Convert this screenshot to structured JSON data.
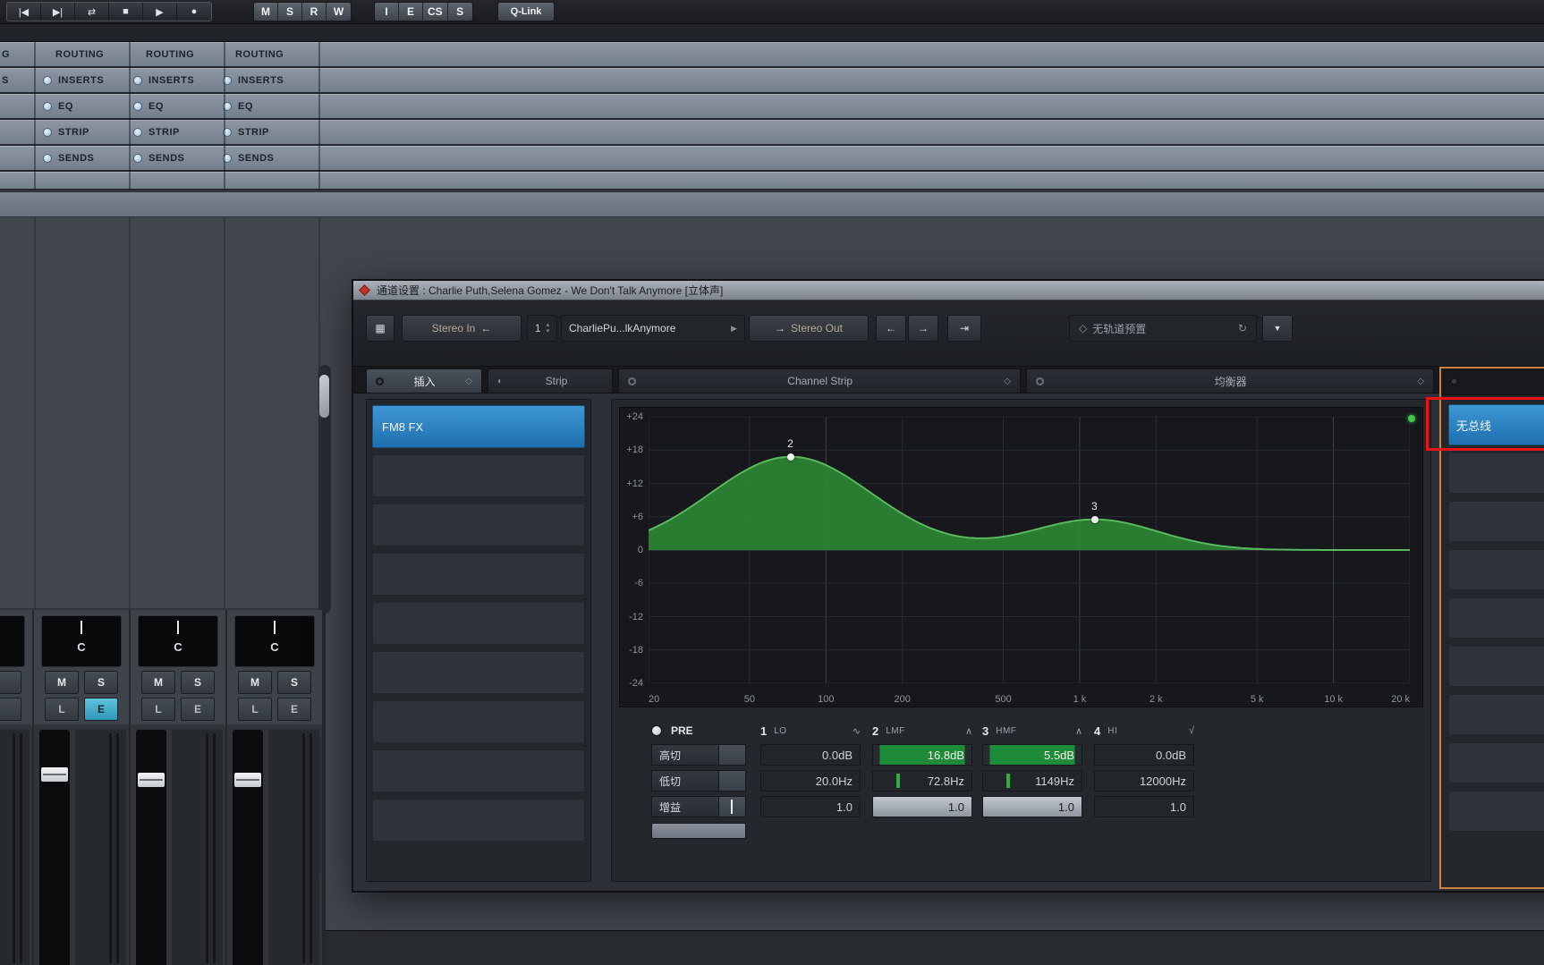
{
  "transport": {
    "to_start_icon": "|◀",
    "to_end_icon": "▶|",
    "cycle_icon": "⇄",
    "stop_icon": "■",
    "play_icon": "▶",
    "record_icon": "●",
    "channel_buttons": [
      "M",
      "S",
      "R",
      "W"
    ],
    "view_buttons": [
      "I",
      "E",
      "CS",
      "S"
    ],
    "qlink_label": "Q-Link"
  },
  "rack": {
    "edge_cut_labels": [
      "G",
      "S"
    ],
    "columns": [
      {
        "labels": [
          "ROUTING",
          "INSERTS",
          "EQ",
          "STRIP",
          "SENDS"
        ]
      },
      {
        "labels": [
          "ROUTING",
          "INSERTS",
          "EQ",
          "STRIP",
          "SENDS"
        ]
      },
      {
        "labels": [
          "ROUTING",
          "INSERTS",
          "EQ",
          "STRIP",
          "SENDS"
        ]
      }
    ]
  },
  "mixer": {
    "channels": [
      {
        "pan": "C",
        "mute": "M",
        "solo": "S",
        "listen": "L",
        "edit": "E",
        "edit_active": true
      },
      {
        "pan": "C",
        "mute": "M",
        "solo": "S",
        "listen": "L",
        "edit": "E",
        "edit_active": false
      },
      {
        "pan": "C",
        "mute": "M",
        "solo": "S",
        "listen": "L",
        "edit": "E",
        "edit_active": false
      }
    ]
  },
  "dialog": {
    "title": "通道设置 : Charlie Puth,Selena Gomez - We Don't Talk Anymore [立体声]",
    "toolbar": {
      "setup_icon": "▦",
      "input_label": "Stereo In",
      "input_arrow_icon": "←",
      "channel_index": "1",
      "spin_up_icon": "▴",
      "spin_down_icon": "▾",
      "channel_name": "CharliePu...lkAnymore",
      "name_arrow_icon": "▶",
      "output_arrow_icon": "→",
      "output_label": "Stereo Out",
      "nav_left_icon": "←",
      "nav_right_icon": "→",
      "edit_icon": "⇥",
      "preset_diamond_icon": "◇",
      "preset_label": "无轨道预置",
      "preset_refresh_icon": "↻",
      "preset_dropdown_icon": "▼"
    },
    "tabs": {
      "inserts": "插入",
      "strip": "Strip",
      "strip_icon": "◐",
      "channel_strip": "Channel Strip",
      "equalizer": "均衡器",
      "diamond_icon": "◇"
    },
    "inserts": {
      "slot1": "FM8 FX"
    },
    "eq": {
      "db_ticks": [
        "+24",
        "+18",
        "+12",
        "+6",
        "0",
        "-6",
        "-12",
        "-18",
        "-24"
      ],
      "db_tick_values": [
        24,
        18,
        12,
        6,
        0,
        -6,
        -12,
        -18,
        -24
      ],
      "freq_ticks": [
        "20",
        "50",
        "100",
        "200",
        "500",
        "1 k",
        "2 k",
        "5 k",
        "10 k",
        "20 k"
      ],
      "freq_tick_values": [
        20,
        50,
        100,
        200,
        500,
        1000,
        2000,
        5000,
        10000,
        20000
      ],
      "curve": {
        "freq_range_hz": [
          20,
          20000
        ],
        "db_range": [
          -24,
          24
        ],
        "points": [
          {
            "label": "2",
            "freq_hz": 72.8,
            "gain_db": 16.8,
            "width_log10": 0.45
          },
          {
            "label": "3",
            "freq_hz": 1149,
            "gain_db": 5.5,
            "width_log10": 0.35
          }
        ]
      },
      "pre": {
        "label": "PRE",
        "high_cut": "高切",
        "low_cut": "低切",
        "gain": "增益"
      },
      "bands": [
        {
          "num": "1",
          "type": "LO",
          "icon": "∿",
          "gain": "0.0dB",
          "freq": "20.0Hz",
          "q": "1.0",
          "active": false
        },
        {
          "num": "2",
          "type": "LMF",
          "icon": "∧",
          "gain": "16.8dB",
          "freq": "72.8Hz",
          "q": "1.0",
          "active": true
        },
        {
          "num": "3",
          "type": "HMF",
          "icon": "∧",
          "gain": "5.5dB",
          "freq": "1149Hz",
          "q": "1.0",
          "active": true
        },
        {
          "num": "4",
          "type": "HI",
          "icon": "√",
          "gain": "0.0dB",
          "freq": "12000Hz",
          "q": "1.0",
          "active": false
        }
      ]
    },
    "sends": {
      "slot1": "无总线"
    }
  },
  "colors": {
    "insert_blue": "#2f85c4",
    "eq_green": "#2c8a33",
    "annotation_red": "#ea1212",
    "panel_orange": "#c8823c"
  }
}
